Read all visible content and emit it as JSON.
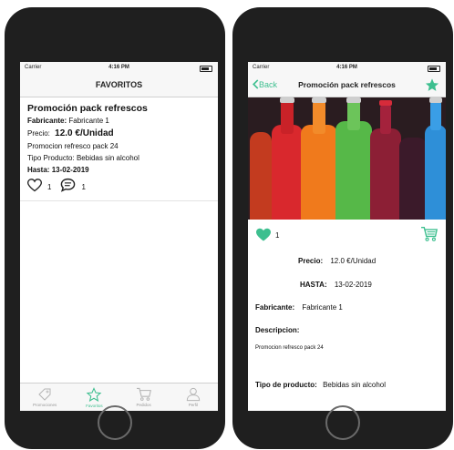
{
  "left_screen": {
    "status": {
      "carrier": "Carrier",
      "time": "4:16 PM"
    },
    "title": "FAVORITOS",
    "item": {
      "title": "Promoción pack refrescos",
      "fabricante_label": "Fabricante:",
      "fabricante_value": "Fabricante 1",
      "precio_label": "Precio:",
      "precio_value": "12.0 €/Unidad",
      "description": "Promocion refresco pack 24",
      "tipo_label": "Tipo Producto:",
      "tipo_value": "Bebidas sin alcohol",
      "hasta_label": "Hasta:",
      "hasta_value": "13-02-2019",
      "likes": "1",
      "comments": "1"
    },
    "tabs": [
      "Promociones",
      "Favoritos",
      "Pedidos",
      "Perfil"
    ]
  },
  "right_screen": {
    "status": {
      "carrier": "Carrier",
      "time": "4:16 PM"
    },
    "back_label": "Back",
    "title": "Promoción pack refrescos",
    "likes": "1",
    "precio_label": "Precio:",
    "precio_value": "12.0 €/Unidad",
    "hasta_label": "HASTA:",
    "hasta_value": "13-02-2019",
    "fabricante_label": "Fabricante:",
    "fabricante_value": "Fabricante 1",
    "descripcion_label": "Descripcion:",
    "descripcion_value": "Promocion refresco pack 24",
    "tipo_label": "Tipo de producto:",
    "tipo_value": "Bebidas sin alcohol"
  },
  "icons": {
    "heart": "heart-icon",
    "comment": "comment-icon",
    "star": "star-icon",
    "cart": "cart-icon",
    "tag": "tag-icon",
    "user": "user-icon",
    "back": "chevron-left-icon"
  },
  "colors": {
    "accent": "#3dbf8f",
    "phone": "#1f1f1f"
  }
}
